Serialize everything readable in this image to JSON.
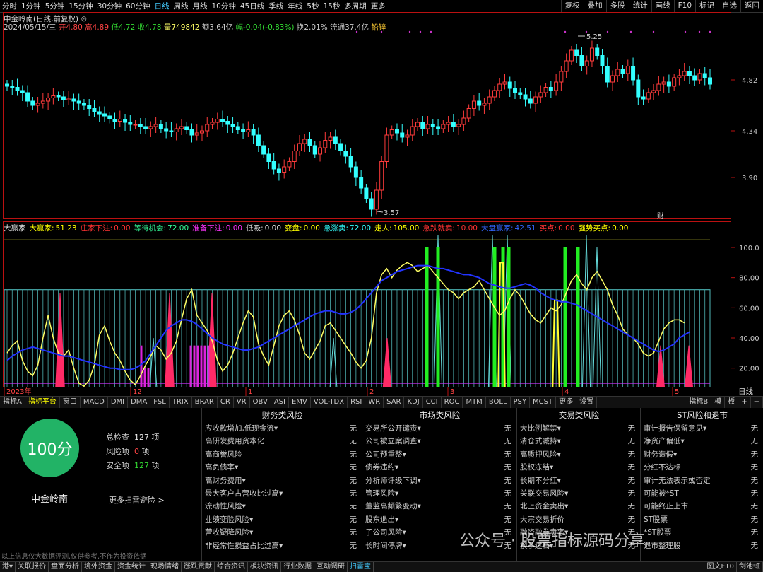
{
  "periods": [
    "分时",
    "1分钟",
    "5分钟",
    "15分钟",
    "30分钟",
    "60分钟",
    "日线",
    "周线",
    "月线",
    "10分钟",
    "45日线",
    "季线",
    "年线",
    "5秒",
    "15秒",
    "多周期",
    "更多"
  ],
  "active_period": "日线",
  "right_buttons": [
    "复权",
    "叠加",
    "多股",
    "统计",
    "画线",
    "F10",
    "标记",
    "自选",
    "返回"
  ],
  "stock_title": "中金岭南(日线,前复权)",
  "quote": {
    "date": "2024/05/15/三",
    "open": "开4.80",
    "high": "高4.89",
    "low": "低4.72",
    "close": "收4.78",
    "volume": "量749842",
    "amount": "额3.64亿",
    "change": "幅-0.04(-0.83%)",
    "turnover": "换2.01%",
    "float": "流通37.4亿",
    "tag": "铅锌"
  },
  "price_axis": [
    "4.82",
    "4.34",
    "3.90"
  ],
  "price_marks": {
    "high": "5.25",
    "low": "3.57"
  },
  "cai_label": "财",
  "indicator": {
    "name": "大赢家",
    "items": [
      {
        "label": "大赢家:",
        "value": "51.23",
        "color": "#ffff00"
      },
      {
        "label": "庄家下注:",
        "value": "0.00",
        "color": "#ff3333"
      },
      {
        "label": "等待机会:",
        "value": "72.00",
        "color": "#33ff99"
      },
      {
        "label": "准备下注:",
        "value": "0.00",
        "color": "#ff33ff"
      },
      {
        "label": "低吸:",
        "value": "0.00",
        "color": "#dddddd"
      },
      {
        "label": "变盘:",
        "value": "0.00",
        "color": "#ffff00"
      },
      {
        "label": "急涨卖:",
        "value": "72.00",
        "color": "#33ffff"
      },
      {
        "label": "走人:",
        "value": "105.00",
        "color": "#ffff00"
      },
      {
        "label": "急跌就卖:",
        "value": "10.00",
        "color": "#ff3333"
      },
      {
        "label": "大盘赢家:",
        "value": "42.51",
        "color": "#3366ff"
      },
      {
        "label": "买点:",
        "value": "0.00",
        "color": "#ff3333"
      },
      {
        "label": "强势买点:",
        "value": "0.00",
        "color": "#ffff00"
      }
    ]
  },
  "ind_axis": [
    "100.0",
    "80.00",
    "60.00",
    "40.00",
    "20.00"
  ],
  "date_axis": [
    "2023年",
    "12",
    "1",
    "2",
    "3",
    "4",
    "5"
  ],
  "period_label": "日线",
  "tabs": [
    "指标A",
    "指标平台",
    "窗口",
    "MACD",
    "DMI",
    "DMA",
    "FSL",
    "TRIX",
    "BRAR",
    "CR",
    "VR",
    "OBV",
    "ASI",
    "EMV",
    "VOL-TDX",
    "RSI",
    "WR",
    "SAR",
    "KDJ",
    "CCI",
    "ROC",
    "MTM",
    "BOLL",
    "PSY",
    "MCST",
    "更多",
    "设置"
  ],
  "tabs_right": [
    "指标B",
    "模",
    "板",
    "+",
    "−"
  ],
  "panel": {
    "score": "100分",
    "stock": "中金岭南",
    "total_label": "总检查",
    "total": "127",
    "total_unit": "项",
    "risk_label": "风险项",
    "risk": "0",
    "risk_unit": "项",
    "safe_label": "安全项",
    "safe": "127",
    "safe_unit": "项",
    "more": "更多扫雷避险 >",
    "columns": [
      {
        "title": "财务类风险",
        "items": [
          "应收款增加,低现金流▾",
          "高研发费用资本化",
          "高商誉风险",
          "高负债率▾",
          "高财务费用▾",
          "最大客户占营收比过高▾",
          "流动性风险▾",
          "业绩变脸风险▾",
          "营收疑降风险▾",
          "非经常性损益占比过高▾"
        ]
      },
      {
        "title": "市场类风险",
        "items": [
          "交易所公开谴责▾",
          "公司被立案调查▾",
          "公司预重整▾",
          "债券违约▾",
          "分析师评级下调▾",
          "管理风险▾",
          "董监高频繁变动▾",
          "股东退出▾",
          "子公司风险▾",
          "长时间停牌▾"
        ]
      },
      {
        "title": "交易类风险",
        "items": [
          "大比例解禁▾",
          "清仓式减持▾",
          "高质押风险▾",
          "股权冻结▾",
          "长期不分红▾",
          "关联交易风险▾",
          "北上资金卖出▾",
          "大宗交易折价",
          "融资融券卖率▾",
          "换手过高▾"
        ]
      },
      {
        "title": "ST风险和退市",
        "items": [
          "审计报告保留意见▾",
          "净资产偏低▾",
          "财务造假▾",
          "分红不达标",
          "审计无法表示或否定",
          "可能被*ST",
          "可能终止上市",
          "ST股票",
          "*ST股票",
          "退市整理股"
        ]
      }
    ],
    "none": "无"
  },
  "disclaimer": "以上信息仅大数据评测,仅供参考,不作为投资依据",
  "bottom": [
    "港▾",
    "关联报价",
    "盘面分析",
    "境外资金",
    "资金统计",
    "现场情绪",
    "涨跌贡献",
    "综合资讯",
    "板块资讯",
    "行业数据",
    "互动调研",
    "扫雷宝"
  ],
  "bottom_active": "扫雷宝",
  "bottom_right": [
    "图文F10",
    "剑池虹"
  ],
  "watermark": "公众号 · 股票指标源码分享"
}
